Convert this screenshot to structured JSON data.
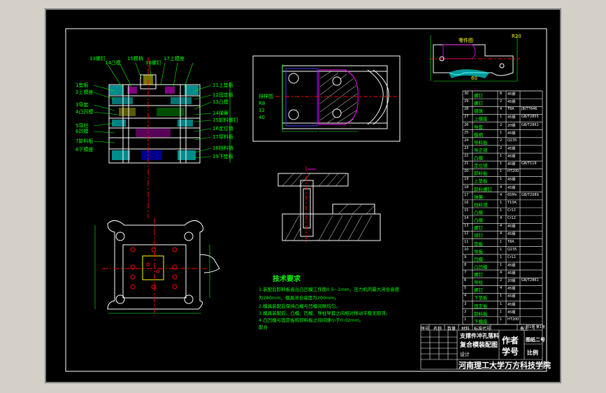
{
  "parts_list": [
    {
      "no": "30",
      "name": "螺钉",
      "qty": "8",
      "material": "45钢",
      "std": ""
    },
    {
      "no": "29",
      "name": "螺钉",
      "qty": "2",
      "material": "45钢",
      "std": ""
    },
    {
      "no": "28",
      "name": "钢珠",
      "qty": "4",
      "material": "T8A",
      "std": "JB/T7646"
    },
    {
      "no": "27",
      "name": "上模座",
      "qty": "1",
      "material": "45钢",
      "std": "GB/T2855"
    },
    {
      "no": "26",
      "name": "导套",
      "qty": "2",
      "material": "20钢",
      "std": "GB/T2861"
    },
    {
      "no": "25",
      "name": "模柄",
      "qty": "1",
      "material": "45钢",
      "std": ""
    },
    {
      "no": "24",
      "name": "导料板",
      "qty": "2",
      "material": "Q235",
      "std": ""
    },
    {
      "no": "23",
      "name": "导正销",
      "qty": "2",
      "material": "45钢",
      "std": ""
    },
    {
      "no": "22",
      "name": "凸模",
      "qty": "1",
      "material": "45钢",
      "std": ""
    },
    {
      "no": "21",
      "name": "定位销",
      "qty": "1",
      "material": "45钢",
      "std": "GB/T119"
    },
    {
      "no": "20",
      "name": "卸料板",
      "qty": "1",
      "material": "HT200",
      "std": ""
    },
    {
      "no": "19",
      "name": "上垫板",
      "qty": "1",
      "material": "45钢",
      "std": ""
    },
    {
      "no": "18",
      "name": "卸料螺钉",
      "qty": "4",
      "material": "45钢",
      "std": ""
    },
    {
      "no": "17",
      "name": "弹簧",
      "qty": "4",
      "material": "65Mn",
      "std": "GB/T2089"
    },
    {
      "no": "16",
      "name": "挡料销",
      "qty": "1",
      "material": "T10A",
      "std": ""
    },
    {
      "no": "15",
      "name": "凸模",
      "qty": "1",
      "material": "Cr12",
      "std": ""
    },
    {
      "no": "14",
      "name": "凸模",
      "qty": "4",
      "material": "Cr12",
      "std": ""
    },
    {
      "no": "13",
      "name": "螺钉",
      "qty": "4",
      "material": "45钢",
      "std": ""
    },
    {
      "no": "12",
      "name": "销钉",
      "qty": "4",
      "material": "45钢",
      "std": ""
    },
    {
      "no": "11",
      "name": "垫板",
      "qty": "1",
      "material": "T8A",
      "std": ""
    },
    {
      "no": "10",
      "name": "导板",
      "qty": "1",
      "material": "Q235",
      "std": ""
    },
    {
      "no": "9",
      "name": "凹模",
      "qty": "1",
      "material": "Cr12",
      "std": ""
    },
    {
      "no": "8",
      "name": "凸凹模",
      "qty": "1",
      "material": "45钢",
      "std": ""
    },
    {
      "no": "7",
      "name": "螺钉",
      "qty": "4",
      "material": "45钢",
      "std": ""
    },
    {
      "no": "6",
      "name": "导柱",
      "qty": "2",
      "material": "20钢",
      "std": "GB/T2861"
    },
    {
      "no": "5",
      "name": "螺钉",
      "qty": "4",
      "material": "45钢",
      "std": ""
    },
    {
      "no": "4",
      "name": "下垫板",
      "qty": "1",
      "material": "45钢",
      "std": ""
    },
    {
      "no": "3",
      "name": "固定板",
      "qty": "1",
      "material": "45钢",
      "std": ""
    },
    {
      "no": "2",
      "name": "卸料板",
      "qty": "1",
      "material": "45钢",
      "std": ""
    },
    {
      "no": "1",
      "name": "下模座",
      "qty": "1",
      "material": "HT200",
      "std": ""
    }
  ],
  "table_header": [
    "序号",
    "名称",
    "数量",
    "材料",
    "标准代号",
    "备注"
  ],
  "title_block": {
    "drawing_name_line1": "支撑件冲孔落料",
    "drawing_name_line2": "复合模装配图",
    "designer_label": "设计",
    "designer_title": "作者",
    "checker_title": "学号",
    "sheet_info": "共1张 第1张",
    "sheet_no": "图纸二号",
    "scale_label": "比例",
    "school": "河南理工大学万方科技学院"
  },
  "tech_requirements": {
    "title": "技术要求",
    "lines": [
      "1.装配后卸料板高出凸凹模工作面0.5~1mm，压力机的最大闭合高度",
      "为280mm，模具闭合高度为200mm。",
      "2.模具装配后保持凸模与凹模间隙均匀。",
      "3.模具装配后，凸模、凹模、导柱导套之间相对移动平稳无阻滞。",
      "4.凸凹模与固定板和卸料板之间间隙小于0.02mm。",
      "配合"
    ]
  },
  "section_labels_left": [
    "1垫板",
    "2上模座",
    "3导套",
    "4凸凹模",
    "5导柱",
    "6凹模",
    "7卸料板",
    "8下模座"
  ],
  "section_labels_right": [
    "11上垫板",
    "12固定板",
    "13凸模",
    "14弹簧",
    "15卸料螺钉",
    "16定位销",
    "17导料板",
    "18挡料销",
    "19下垫板"
  ],
  "section_labels_top": [
    "13螺钉",
    "14凸模",
    "15模柄",
    "16螺钉",
    "17上模座"
  ],
  "workpiece_labels": {
    "part_name": "零件图",
    "dim_a": "R20",
    "dim_b": "60"
  },
  "strip_labels": {
    "left": "排样图",
    "dims": [
      "R8",
      "32",
      "40"
    ]
  },
  "colors": {
    "line": "#ffffff",
    "text": "#00ff00",
    "highlight": "#ffff00",
    "center": "#ff0000",
    "hatch": "#00ffff",
    "pink": "#ff00ff",
    "blue": "#4040ff"
  }
}
